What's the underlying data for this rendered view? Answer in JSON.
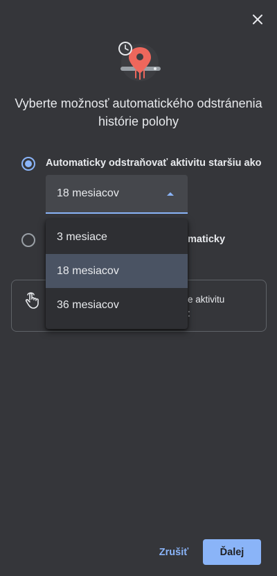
{
  "dialog": {
    "title": "Vyberte možnosť automatického odstránenia histórie polohy",
    "close_icon": "close-icon",
    "hero_icon": "location-history-icon"
  },
  "options": [
    {
      "label": "Automaticky odstraňovať aktivitu staršiu ako",
      "selected": true
    },
    {
      "label": "maticky",
      "selected": false
    }
  ],
  "period_select": {
    "value": "18 mesiacov",
    "expanded": true,
    "menu": [
      "3 mesiace",
      "18 mesiacov",
      "36 mesiacov"
    ],
    "selected_index": 1
  },
  "info_card": {
    "icon": "touch-hand-icon",
    "text_line1": "e aktivitu",
    "text_line2": ":"
  },
  "footer": {
    "cancel_label": "Zrušiť",
    "next_label": "Ďalej"
  },
  "colors": {
    "background": "#35363a",
    "accent": "#8ab4f8",
    "hero_pin": "#ee675c"
  }
}
